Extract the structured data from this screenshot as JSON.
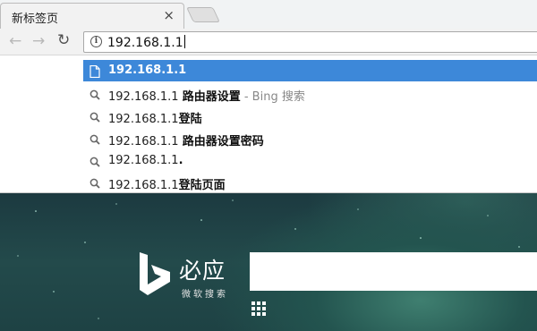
{
  "tab": {
    "title": "新标签页",
    "close": "×"
  },
  "toolbar": {
    "back": "←",
    "forward": "→",
    "reload": "↻"
  },
  "omnibox": {
    "info": "i",
    "value": "192.168.1.1"
  },
  "suggestions": [
    {
      "prefix": "192.168.1.1",
      "bold": "",
      "hint": "",
      "icon": "page-icon",
      "selected": true
    },
    {
      "prefix": "192.168.1.1 ",
      "bold": "路由器设置",
      "hint": " - Bing 搜索",
      "icon": "search-icon",
      "selected": false
    },
    {
      "prefix": "192.168.1.1",
      "bold": "登陆",
      "hint": "",
      "icon": "search-icon",
      "selected": false
    },
    {
      "prefix": "192.168.1.1 ",
      "bold": "路由器设置密码",
      "hint": "",
      "icon": "search-icon",
      "selected": false
    },
    {
      "prefix": "192.168.1.1",
      "bold": ".",
      "hint": "",
      "icon": "search-icon",
      "selected": false
    },
    {
      "prefix": "192.168.1.1",
      "bold": "登陆页面",
      "hint": "",
      "icon": "search-icon",
      "selected": false
    }
  ],
  "bing": {
    "name": "必应",
    "tagline": "微软搜索"
  },
  "colors": {
    "selection": "#3d88d9",
    "hero_dark": "#1c3a40",
    "hero_glow": "#3f7f70"
  }
}
